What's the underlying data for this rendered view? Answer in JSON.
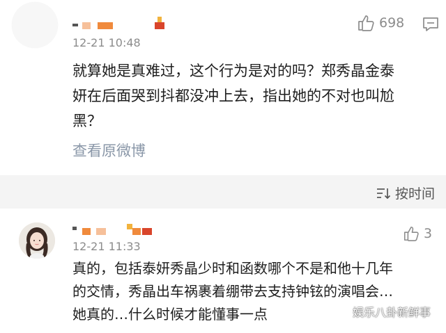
{
  "comment1": {
    "timestamp": "12-21 10:48",
    "likes": "698",
    "text_lines": [
      "就算她是真难过，这个行为是对的吗？郑秀晶金泰",
      "妍在后面哭到抖都没冲上去，指出她的不对也叫尬",
      "黑？"
    ],
    "view_original": "查看原微博"
  },
  "sort": {
    "label": "按时间"
  },
  "comment2": {
    "timestamp": "12-21 11:33",
    "likes": "3",
    "text_lines": [
      "真的，包括泰妍秀晶少时和函数哪个不是和他十几年",
      "的交情，秀晶出车祸裹着绷带去支持钟铉的演唱会…",
      "她真的…什么时候才能懂事一点"
    ]
  },
  "watermark": {
    "text": "娱乐八卦新鲜事"
  },
  "colors": {
    "text": "#1e1e1e",
    "meta": "#8c8c8c",
    "link": "#8a97a8",
    "band": "#f4f4f4",
    "redact_orange": "#f08a3c",
    "redact_red": "#d9452b",
    "redact_yellow": "#f2b33d"
  },
  "icons": {
    "like": "thumbs-up-icon",
    "comment": "comment-icon",
    "sort": "sort-icon",
    "watermark": "wechat-icon"
  }
}
